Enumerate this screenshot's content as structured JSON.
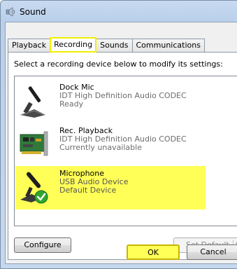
{
  "window": {
    "title": "Sound"
  },
  "tabs": [
    {
      "label": "Playback"
    },
    {
      "label": "Recording"
    },
    {
      "label": "Sounds"
    },
    {
      "label": "Communications"
    }
  ],
  "active_tab": "Recording",
  "instruction": "Select a recording device below to modify its settings:",
  "devices": [
    {
      "name": "Dock Mic",
      "driver": "IDT High Definition Audio CODEC",
      "status": "Ready",
      "icon": "microphone-icon"
    },
    {
      "name": "Rec. Playback",
      "driver": "IDT High Definition Audio CODEC",
      "status": "Currently unavailable",
      "icon": "sound-card-icon"
    },
    {
      "name": "Microphone",
      "driver": "USB Audio Device",
      "status": "Default Device",
      "icon": "microphone-default-icon"
    }
  ],
  "buttons": {
    "configure": "Configure",
    "set_default": "Set Default",
    "ok": "OK",
    "cancel": "Cancel"
  },
  "colors": {
    "highlight": "#ffff57",
    "default_check": "#2fa52f"
  }
}
